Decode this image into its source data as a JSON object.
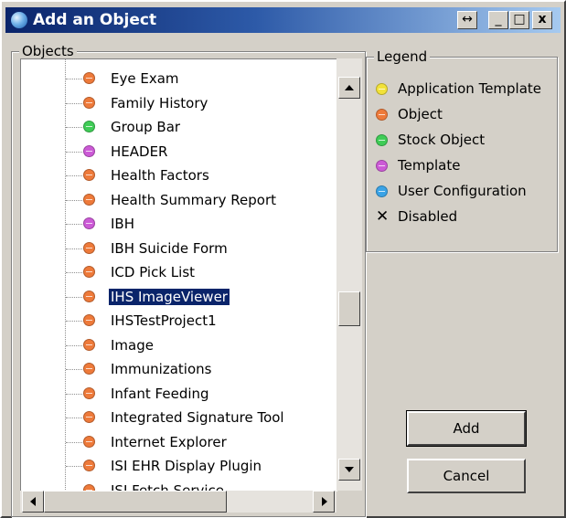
{
  "window": {
    "title": "Add an Object",
    "controls": {
      "restore": "↔",
      "minimize": "_",
      "maximize": "□",
      "close": "x"
    }
  },
  "objects_panel": {
    "label": "Objects",
    "items": [
      {
        "label": "Eye Exam",
        "type": "object"
      },
      {
        "label": "Family History",
        "type": "object"
      },
      {
        "label": "Group Bar",
        "type": "stock"
      },
      {
        "label": "HEADER",
        "type": "template"
      },
      {
        "label": "Health Factors",
        "type": "object"
      },
      {
        "label": "Health Summary Report",
        "type": "object"
      },
      {
        "label": "IBH",
        "type": "template"
      },
      {
        "label": "IBH Suicide Form",
        "type": "object"
      },
      {
        "label": "ICD Pick List",
        "type": "object"
      },
      {
        "label": "IHS ImageViewer",
        "type": "object",
        "selected": true
      },
      {
        "label": "IHSTestProject1",
        "type": "object"
      },
      {
        "label": "Image",
        "type": "object"
      },
      {
        "label": "Immunizations",
        "type": "object"
      },
      {
        "label": "Infant Feeding",
        "type": "object"
      },
      {
        "label": "Integrated Signature Tool",
        "type": "object"
      },
      {
        "label": "Internet Explorer",
        "type": "object"
      },
      {
        "label": "ISI EHR Display Plugin",
        "type": "object"
      },
      {
        "label": "ISI Fetch Service",
        "type": "object"
      }
    ]
  },
  "legend": {
    "label": "Legend",
    "items": [
      {
        "label": "Application Template",
        "type": "application-template"
      },
      {
        "label": "Object",
        "type": "object"
      },
      {
        "label": "Stock Object",
        "type": "stock"
      },
      {
        "label": "Template",
        "type": "template"
      },
      {
        "label": "User Configuration",
        "type": "user-configuration"
      },
      {
        "label": "Disabled",
        "type": "disabled",
        "glyph": "✕"
      }
    ]
  },
  "colors": {
    "application-template": "#f2e23a",
    "object": "#ee7a3a",
    "stock": "#3fcc56",
    "template": "#cc5ad6",
    "user-configuration": "#3aa3e6",
    "selection": "#0a246a",
    "titlebar": "#0a246a"
  },
  "buttons": {
    "add": "Add",
    "cancel": "Cancel"
  }
}
